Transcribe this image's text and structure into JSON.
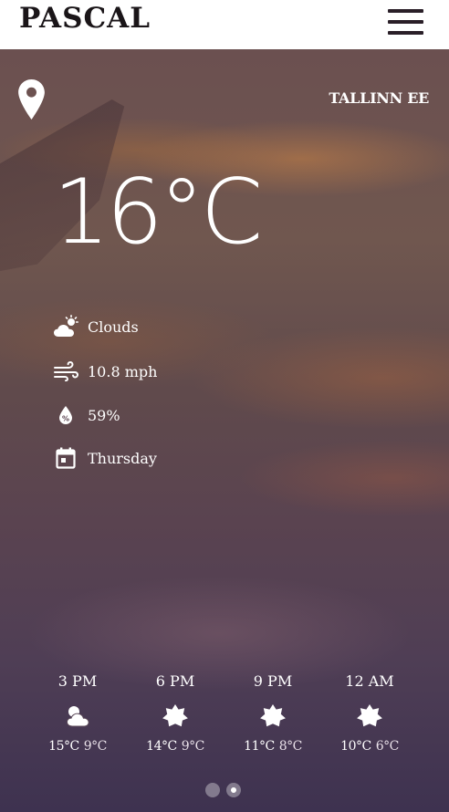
{
  "header": {
    "brand": "PASCAL",
    "menu_icon": "hamburger-menu-icon"
  },
  "location": {
    "icon": "map-pin-icon",
    "city": "TALLINN",
    "country": "EE"
  },
  "current": {
    "temperature": "16°C",
    "details": [
      {
        "icon": "clouds-icon",
        "text": "Clouds"
      },
      {
        "icon": "wind-icon",
        "text": "10.8 mph"
      },
      {
        "icon": "humidity-drop-icon",
        "text": "59%"
      },
      {
        "icon": "calendar-icon",
        "text": "Thursday"
      }
    ]
  },
  "forecast": [
    {
      "time": "3 PM",
      "icon": "clouds-icon",
      "high": "15°C",
      "low": "9°C"
    },
    {
      "time": "6 PM",
      "icon": "sun-icon",
      "high": "14°C",
      "low": "9°C"
    },
    {
      "time": "9 PM",
      "icon": "sun-icon",
      "high": "11°C",
      "low": "8°C"
    },
    {
      "time": "12 AM",
      "icon": "sun-icon",
      "high": "10°C",
      "low": "6°C"
    }
  ],
  "pager": {
    "pages": 2,
    "active": 2
  },
  "colors": {
    "header_bg": "#ffffff",
    "brand_text": "#1a1518",
    "text": "#ffffff"
  }
}
